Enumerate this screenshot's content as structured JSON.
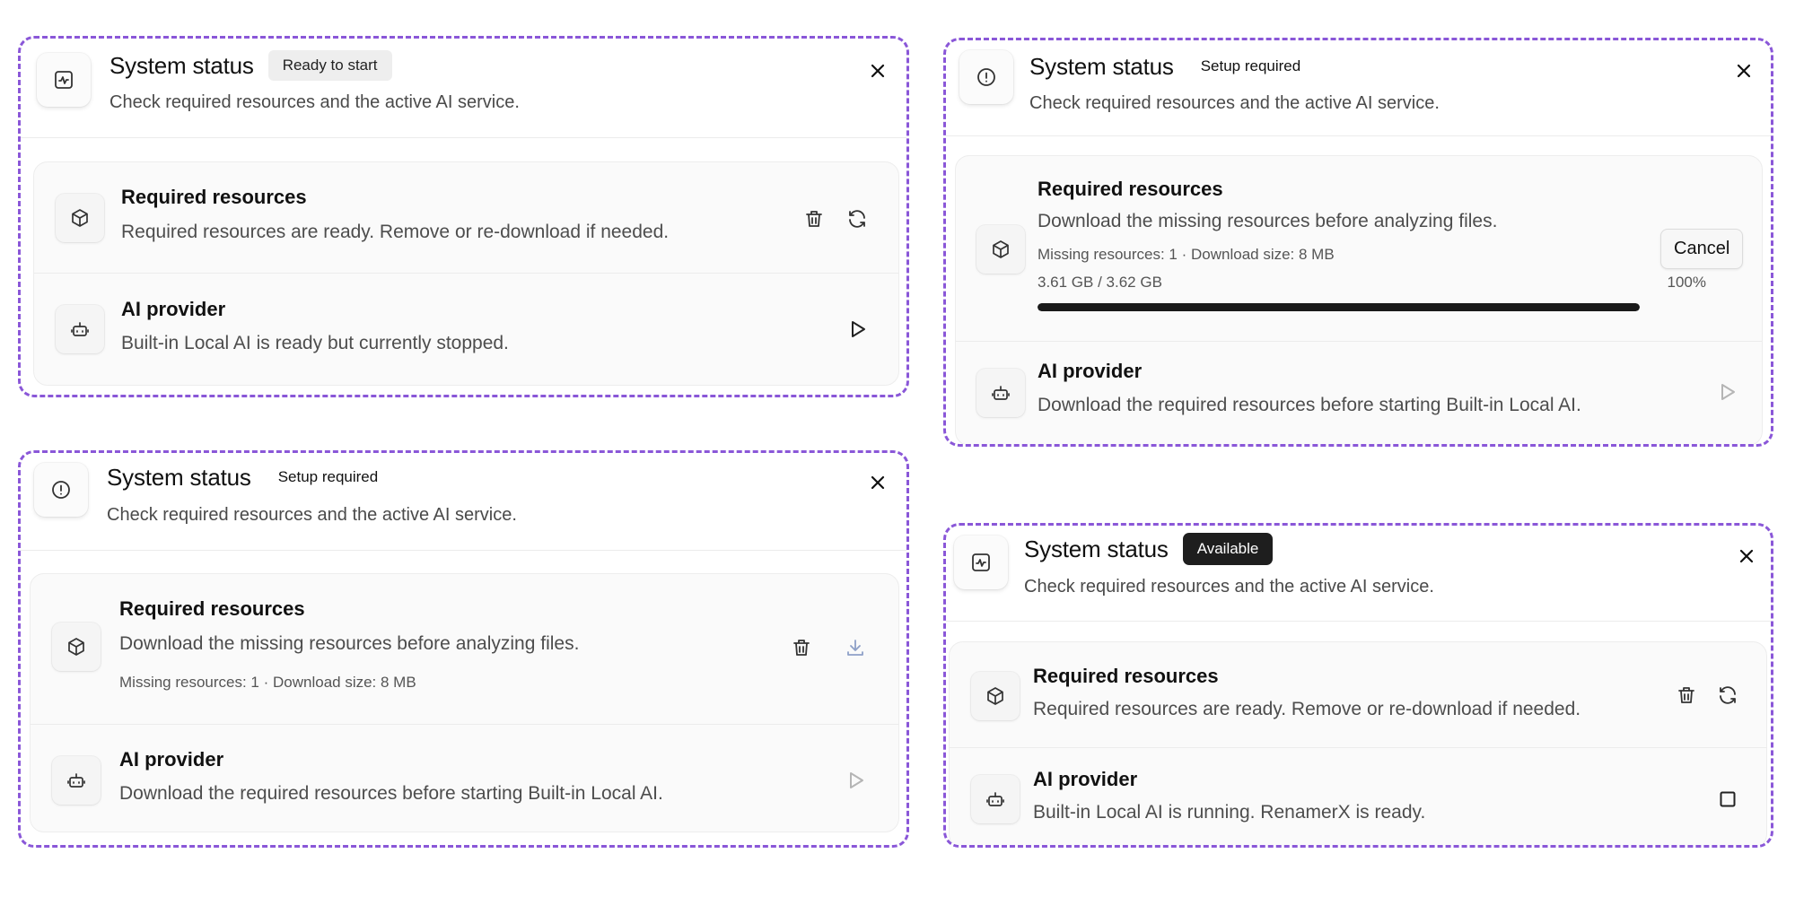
{
  "colors": {
    "panel_border": "#8a57d8",
    "badge_dark": "#1e1e1e",
    "progress_fill": "#1a1a1a"
  },
  "panels": [
    {
      "title": "System status",
      "badge": "Ready to start",
      "subtitle": "Check required resources and the active AI service.",
      "header_icon": "activity-icon",
      "resources": {
        "title": "Required resources",
        "description": "Required resources are ready. Remove or re-download if needed.",
        "actions": [
          "trash-icon",
          "refresh-icon"
        ]
      },
      "provider": {
        "title": "AI provider",
        "description": "Built-in Local AI is ready but currently stopped.",
        "action": "play-icon"
      }
    },
    {
      "title": "System status",
      "badge": "Setup required",
      "subtitle": "Check required resources and the active AI service.",
      "header_icon": "alert-circle-icon",
      "resources": {
        "title": "Required resources",
        "description": "Download the missing resources before analyzing files.",
        "meta": "Missing resources: 1 · Download size: 8 MB",
        "progress_text": "3.61 GB / 3.62 GB",
        "progress_percent": "100%",
        "progress_value": 100,
        "cancel_label": "Cancel"
      },
      "provider": {
        "title": "AI provider",
        "description": "Download the required resources before starting Built-in Local AI.",
        "action": "play-icon"
      }
    },
    {
      "title": "System status",
      "badge": "Setup required",
      "subtitle": "Check required resources and the active AI service.",
      "header_icon": "alert-circle-icon",
      "resources": {
        "title": "Required resources",
        "description": "Download the missing resources before analyzing files.",
        "meta": "Missing resources: 1 · Download size: 8 MB",
        "actions": [
          "trash-icon",
          "download-icon"
        ]
      },
      "provider": {
        "title": "AI provider",
        "description": "Download the required resources before starting Built-in Local AI.",
        "action": "play-icon"
      }
    },
    {
      "title": "System status",
      "badge": "Available",
      "subtitle": "Check required resources and the active AI service.",
      "header_icon": "activity-icon",
      "resources": {
        "title": "Required resources",
        "description": "Required resources are ready. Remove or re-download if needed.",
        "actions": [
          "trash-icon",
          "refresh-icon"
        ]
      },
      "provider": {
        "title": "AI provider",
        "description": "Built-in Local AI is running. RenamerX is ready.",
        "action": "stop-icon"
      }
    }
  ]
}
